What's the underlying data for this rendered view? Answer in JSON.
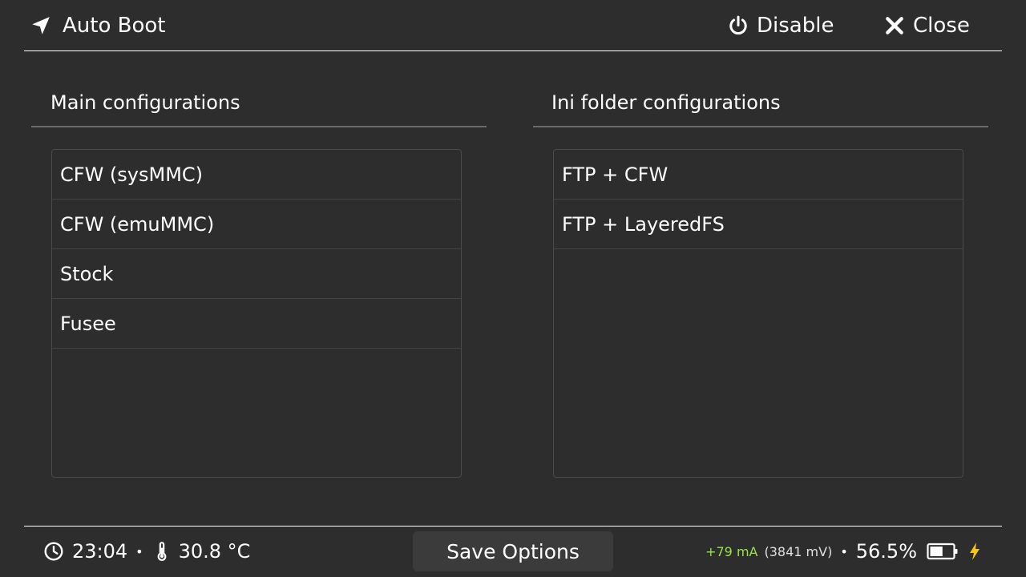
{
  "header": {
    "title": "Auto Boot",
    "disable_label": "Disable",
    "close_label": "Close"
  },
  "main_section": {
    "title": "Main configurations",
    "items": [
      {
        "label": "CFW (sysMMC)"
      },
      {
        "label": "CFW (emuMMC)"
      },
      {
        "label": "Stock"
      },
      {
        "label": "Fusee"
      }
    ]
  },
  "ini_section": {
    "title": "Ini folder configurations",
    "items": [
      {
        "label": "FTP + CFW"
      },
      {
        "label": "FTP + LayeredFS"
      }
    ]
  },
  "footer": {
    "time": "23:04",
    "separator": "•",
    "temperature": "30.8 °C",
    "save_label": "Save Options",
    "current": "+79 mA",
    "voltage": "(3841 mV)",
    "battery_percent": "56.5%",
    "battery_fill": 0.565,
    "charge_color": "#f5c518",
    "current_color": "#99e24c"
  },
  "icons": {
    "title": "navigation-arrow-icon",
    "disable": "power-icon",
    "close": "close-x-icon",
    "time": "clock-icon",
    "temperature": "thermometer-icon",
    "battery": "battery-icon",
    "charging": "lightning-bolt-icon"
  }
}
